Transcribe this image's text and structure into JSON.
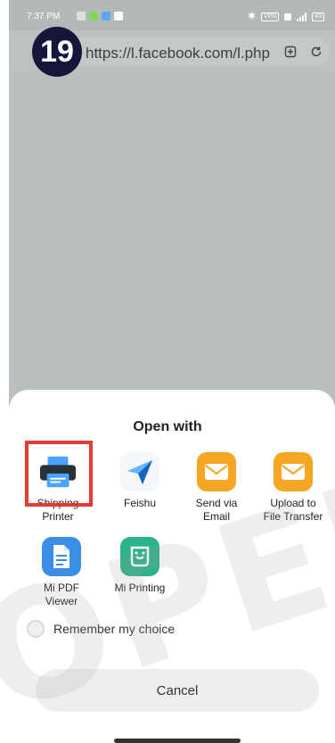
{
  "step": {
    "number": "19"
  },
  "status_bar": {
    "time": "7:37 PM",
    "battery": "43"
  },
  "browser": {
    "url": "https://l.facebook.com/l.php"
  },
  "sheet": {
    "title": "Open with",
    "apps": [
      {
        "label_line1": "Shipping",
        "label_line2": "Printer",
        "icon": "printer-icon",
        "color": "#1e6fd9"
      },
      {
        "label_line1": "Feishu",
        "label_line2": "",
        "icon": "feishu-paper-plane-icon",
        "color": "#1e88e5"
      },
      {
        "label_line1": "Send via",
        "label_line2": "Email",
        "icon": "mail-envelope-icon",
        "color": "#f5a623"
      },
      {
        "label_line1": "Upload to",
        "label_line2": "File Transfer",
        "icon": "mail-envelope-icon",
        "color": "#f5a623"
      },
      {
        "label_line1": "Mi PDF",
        "label_line2": "Viewer",
        "icon": "pdf-document-icon",
        "color": "#3a8ee6"
      },
      {
        "label_line1": "Mi Printing",
        "label_line2": "",
        "icon": "mi-printing-icon",
        "color": "#2db38a"
      }
    ],
    "remember_label": "Remember my choice",
    "cancel_label": "Cancel"
  },
  "watermark": {
    "text": "OPEN"
  }
}
